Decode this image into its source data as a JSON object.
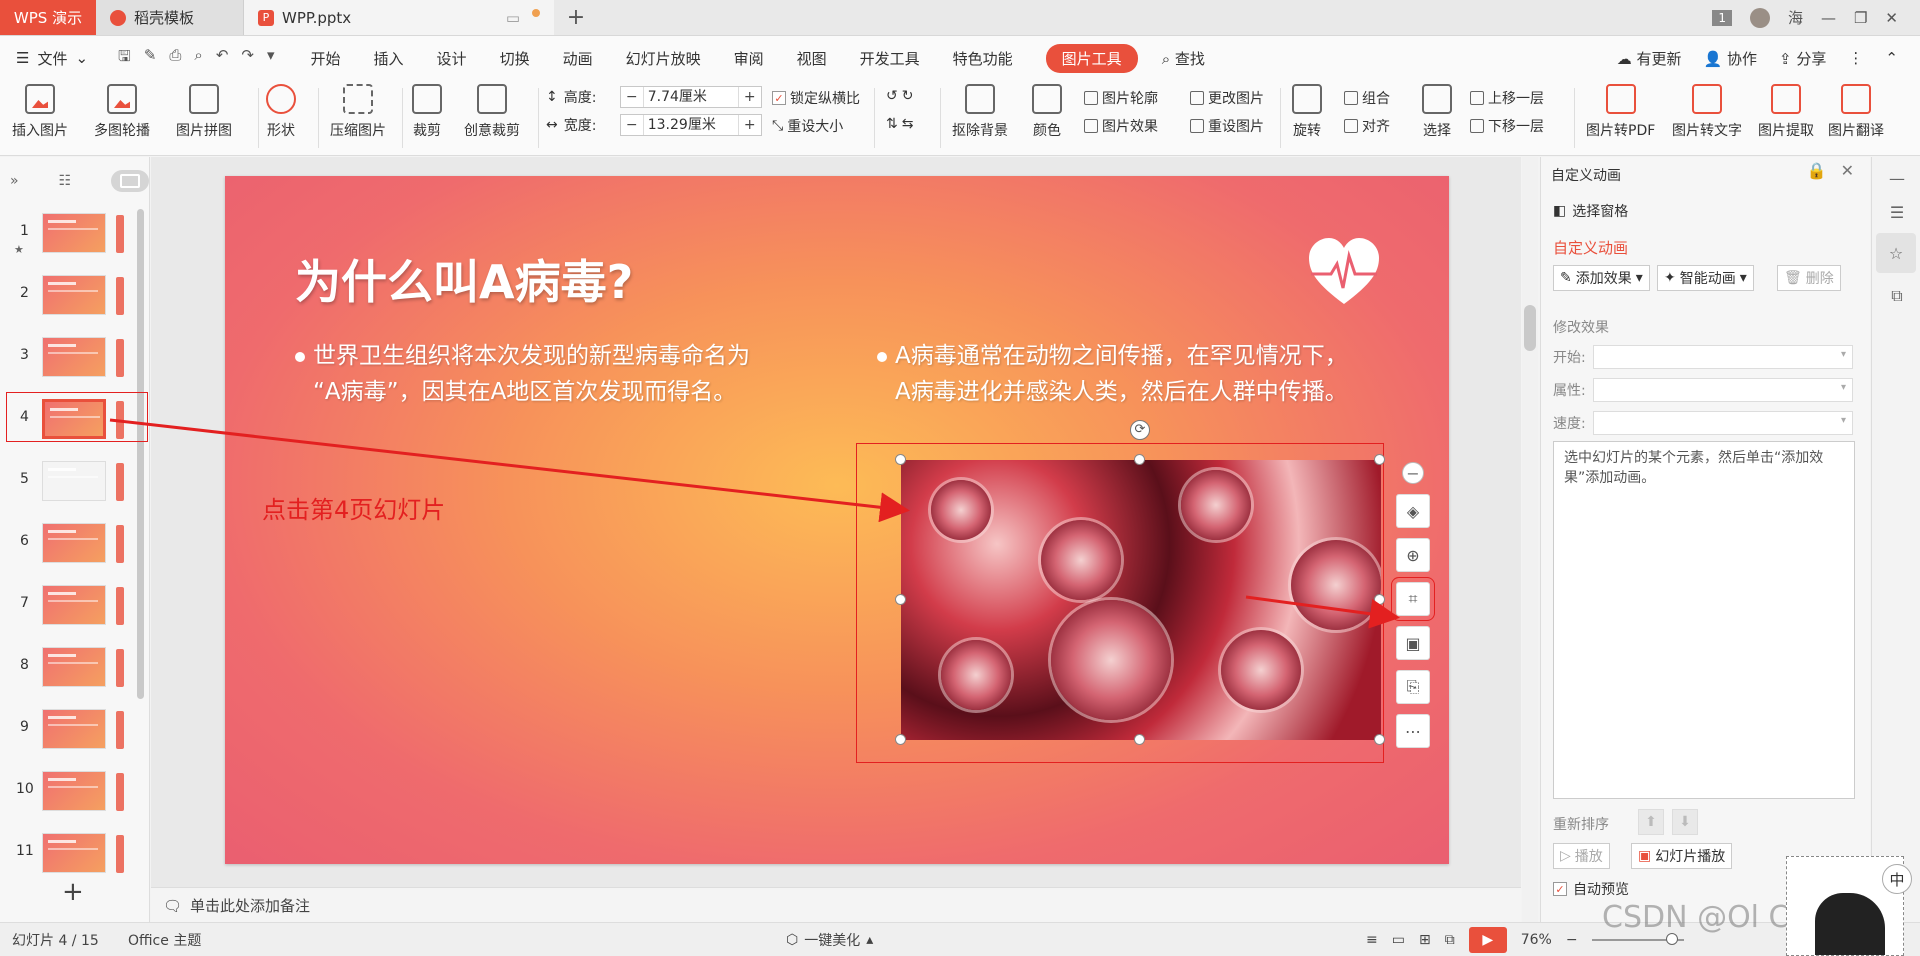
{
  "titlebar": {
    "app_tab": "WPS 演示",
    "tabs": [
      {
        "label": "稻壳模板"
      },
      {
        "label": "WPP.pptx"
      }
    ],
    "new_tab": "+",
    "page_badge": "1",
    "user": "海"
  },
  "menubar": {
    "file": "文件",
    "items": [
      "开始",
      "插入",
      "设计",
      "切换",
      "动画",
      "幻灯片放映",
      "审阅",
      "视图",
      "开发工具",
      "特色功能"
    ],
    "picture_tools": "图片工具",
    "search": "查找",
    "right": [
      "有更新",
      "协作",
      "分享"
    ]
  },
  "ribbon": {
    "insert_picture": "插入图片",
    "multi_carousel": "多图轮播",
    "picture_collage": "图片拼图",
    "shape": "形状",
    "compress": "压缩图片",
    "crop": "裁剪",
    "creative_crop": "创意裁剪",
    "height_label": "高度:",
    "height_value": "7.74厘米",
    "width_label": "宽度:",
    "width_value": "13.29厘米",
    "lock_ratio": "锁定纵横比",
    "reset_size": "重设大小",
    "remove_bg": "抠除背景",
    "color": "颜色",
    "pic_outline": "图片轮廓",
    "pic_effect": "图片效果",
    "change_pic": "更改图片",
    "reset_pic": "重设图片",
    "rotate": "旋转",
    "group": "组合",
    "align": "对齐",
    "select": "选择",
    "bring_forward": "上移一层",
    "send_backward": "下移一层",
    "to_pdf": "图片转PDF",
    "to_text": "图片转文字",
    "extract": "图片提取",
    "translate": "图片翻译"
  },
  "slides": {
    "numbers": [
      "1",
      "2",
      "3",
      "4",
      "5",
      "6",
      "7",
      "8",
      "9",
      "10",
      "11"
    ],
    "selected": 4
  },
  "slide": {
    "title": "为什么叫A病毒?",
    "bullet_left_1": "世界卫生组织将本次发现的新型病毒命名为",
    "bullet_left_2": "“A病毒”，因其在A地区首次发现而得名。",
    "bullet_right_1": "A病毒通常在动物之间传播，在罕见情况下，",
    "bullet_right_2": "A病毒进化并感染人类，然后在人群中传播。"
  },
  "annotation": "点击第4页幻灯片",
  "notes_placeholder": "单击此处添加备注",
  "animation_pane": {
    "title": "自定义动画",
    "selection_pane": "选择窗格",
    "section": "自定义动画",
    "add_effect": "添加效果",
    "smart_anim": "智能动画",
    "delete": "删除",
    "modify": "修改效果",
    "start": "开始:",
    "property": "属性:",
    "speed": "速度:",
    "hint": "选中幻灯片的某个元素，然后单击“添加效果”添加动画。",
    "reorder": "重新排序",
    "play": "播放",
    "slideshow": "幻灯片播放",
    "auto_preview": "自动预览"
  },
  "statusbar": {
    "slide_count": "幻灯片 4 / 15",
    "theme": "Office 主题",
    "beautify": "一键美化",
    "zoom": "76%"
  },
  "watermark": "CSDN @Ol Correa",
  "ime": "中"
}
